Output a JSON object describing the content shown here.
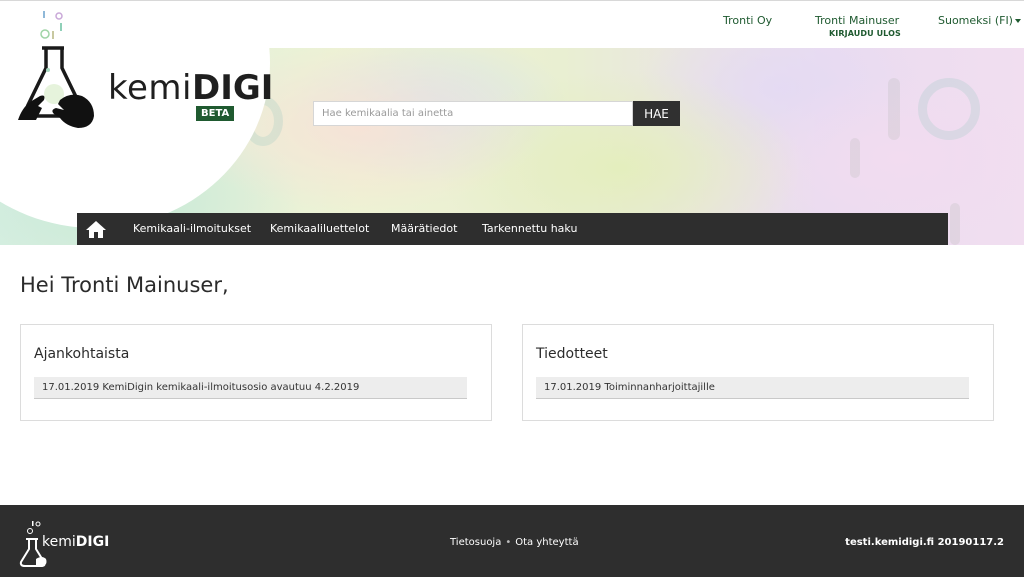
{
  "topbar": {
    "company": "Tronti Oy",
    "user_name": "Tronti Mainuser",
    "logout_label": "KIRJAUDU ULOS",
    "language": "Suomeksi (FI)"
  },
  "logo": {
    "word_light": "kemi",
    "word_bold": "DIGI",
    "badge": "BETA"
  },
  "search": {
    "placeholder": "Hae kemikaalia tai ainetta",
    "button_label": "HAE"
  },
  "nav": {
    "items": [
      {
        "label": "Kemikaali-ilmoitukset"
      },
      {
        "label": "Kemikaaliluettelot"
      },
      {
        "label": "Määrätiedot"
      },
      {
        "label": "Tarkennettu haku"
      }
    ]
  },
  "main": {
    "greeting": "Hei Tronti Mainuser,",
    "cards": [
      {
        "title": "Ajankohtaista",
        "items": [
          "17.01.2019 KemiDigin kemikaali-ilmoitusosio avautuu 4.2.2019"
        ]
      },
      {
        "title": "Tiedotteet",
        "items": [
          "17.01.2019 Toiminnanharjoittajille"
        ]
      }
    ]
  },
  "footer": {
    "logo_light": "kemi",
    "logo_bold": "DIGI",
    "links": [
      "Tietosuoja",
      "Ota yhteyttä"
    ],
    "version": "testi.kemidigi.fi 20190117.2"
  },
  "colors": {
    "brand_green": "#1f5a30",
    "dark_bar": "#2e2e2e"
  }
}
